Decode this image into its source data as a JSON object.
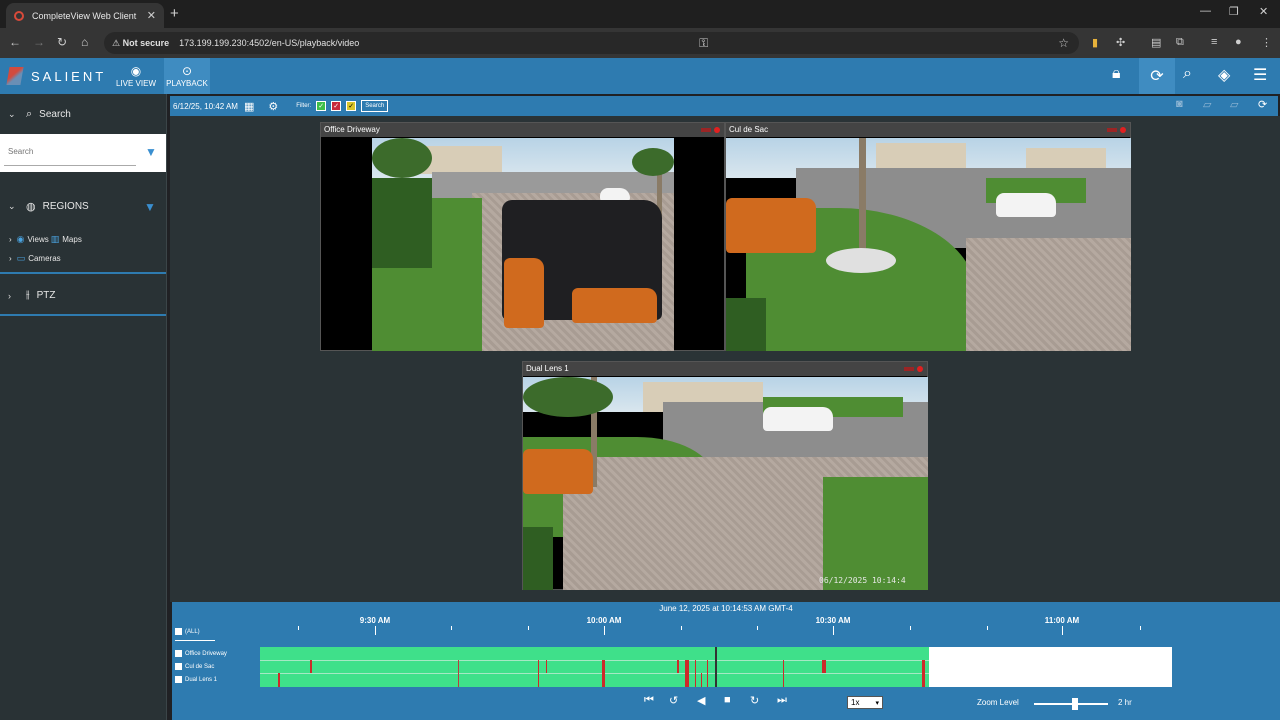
{
  "browser": {
    "tab_title": "CompleteView Web Client",
    "new_tab": "+",
    "close_tab": "✕",
    "security": "Not secure",
    "url": "173.199.199.230:4502/en-US/playback/video"
  },
  "app": {
    "logo_text": "SALIENT",
    "nav": {
      "live_view": "LIVE VIEW",
      "playback": "PLAYBACK"
    }
  },
  "sidebar": {
    "search_label": "Search",
    "search_placeholder": "Search",
    "regions_label": "REGIONS",
    "views_label": "Views",
    "maps_label": "Maps",
    "cameras_label": "Cameras",
    "ptz_label": "PTZ"
  },
  "toolbar": {
    "datetime": "6/12/25, 10:42 AM",
    "filter_label": "Filter:",
    "search_button": "Search",
    "filters": [
      {
        "color": "#3fbf4a",
        "checked": true
      },
      {
        "color": "#c8283c",
        "checked": true
      },
      {
        "color": "#d9c62b",
        "checked": true
      }
    ]
  },
  "cameras": [
    {
      "title": "Office Driveway"
    },
    {
      "title": "Cul de Sac"
    },
    {
      "title": "Dual Lens 1",
      "timestamp": "06/12/2025 10:14:4"
    }
  ],
  "timeline": {
    "date_label": "June 12, 2025 at 10:14:53 AM GMT-4",
    "ticks": [
      "9:30 AM",
      "10:00 AM",
      "10:30 AM",
      "11:00 AM"
    ],
    "all_label": "(ALL)",
    "rows": [
      "Office Driveway",
      "Cul de Sac",
      "Dual Lens 1"
    ],
    "speed": "1x",
    "zoom_label": "Zoom Level",
    "zoom_value": "2 hr",
    "zoom_level": 0.55
  },
  "colors": {
    "accent": "#2e7bb0",
    "recording": "#3fe08a",
    "event": "#cc2a2a"
  }
}
